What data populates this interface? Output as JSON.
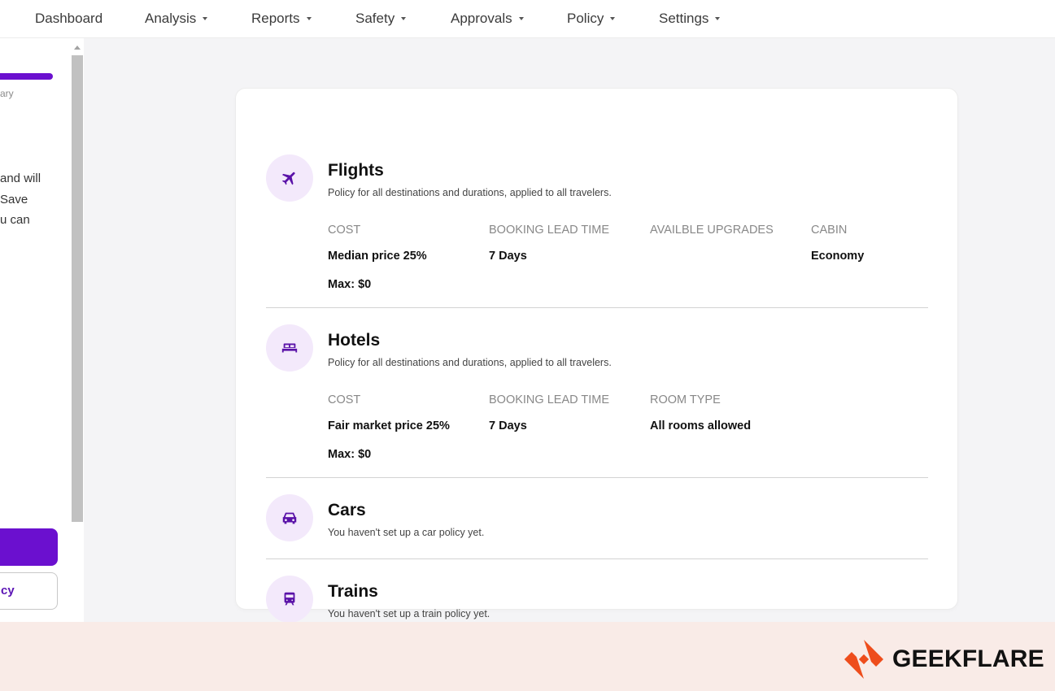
{
  "nav": {
    "items": [
      {
        "label": "Dashboard",
        "has_caret": false
      },
      {
        "label": "Analysis",
        "has_caret": true
      },
      {
        "label": "Reports",
        "has_caret": true
      },
      {
        "label": "Safety",
        "has_caret": true
      },
      {
        "label": "Approvals",
        "has_caret": true
      },
      {
        "label": "Policy",
        "has_caret": true
      },
      {
        "label": "Settings",
        "has_caret": true
      }
    ]
  },
  "sidebar": {
    "step_label": "ary",
    "description_lines": [
      "and will",
      "Save",
      "u can"
    ],
    "secondary_button_label": "cy"
  },
  "policies": [
    {
      "icon": "airplane-icon",
      "title": "Flights",
      "subtitle": "Policy for all destinations and durations, applied to all travelers.",
      "columns": [
        "COST",
        "BOOKING LEAD TIME",
        "AVAILBLE UPGRADES",
        "CABIN"
      ],
      "values": [
        "Median price 25%",
        "7 Days",
        "",
        "Economy"
      ],
      "max": "Max: $0"
    },
    {
      "icon": "bed-icon",
      "title": "Hotels",
      "subtitle": "Policy for all destinations and durations, applied to all travelers.",
      "columns": [
        "COST",
        "BOOKING LEAD TIME",
        "ROOM TYPE"
      ],
      "values": [
        "Fair market price 25%",
        "7 Days",
        "All rooms allowed"
      ],
      "max": "Max: $0"
    },
    {
      "icon": "car-icon",
      "title": "Cars",
      "subtitle": "You haven't set up a car policy yet."
    },
    {
      "icon": "train-icon",
      "title": "Trains",
      "subtitle": "You haven't set up a train policy yet."
    }
  ],
  "colors": {
    "accent": "#6b10cf",
    "icon_bg": "#f3e9fb",
    "brand_orange": "#ee4d1c",
    "watermark_bg": "#f9ebe7"
  },
  "watermark": {
    "icon": "geekflare-logo-icon",
    "text": "GEEKFLARE"
  }
}
